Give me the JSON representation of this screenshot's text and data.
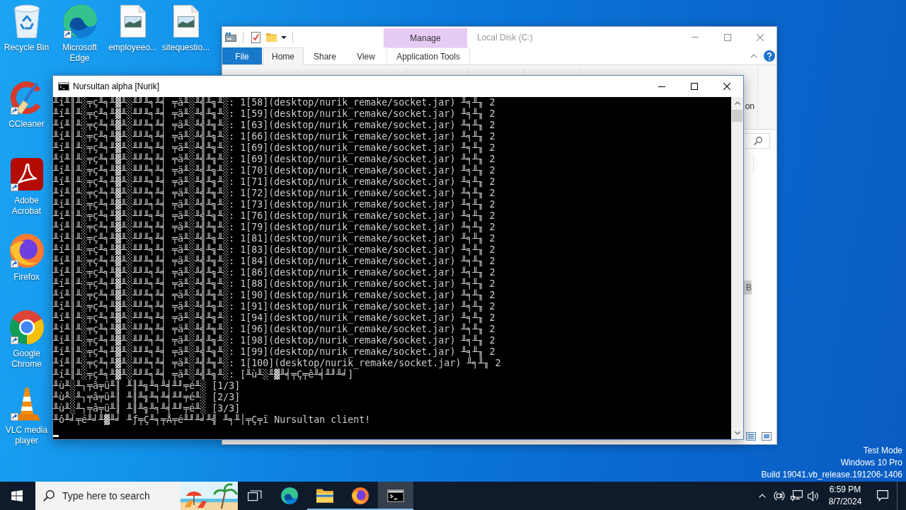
{
  "desktop_icons": [
    {
      "label": "Recycle Bin",
      "kind": "recycle-bin",
      "shortcut": false
    },
    {
      "label": "Microsoft Edge",
      "kind": "edge",
      "shortcut": true
    },
    {
      "label": "employeeo...",
      "kind": "image-file",
      "shortcut": false
    },
    {
      "label": "sitequestio...",
      "kind": "image-file",
      "shortcut": false
    },
    {
      "label": "CCleaner",
      "kind": "ccleaner",
      "shortcut": true
    },
    {
      "label": "Adobe Acrobat",
      "kind": "acrobat",
      "shortcut": true
    },
    {
      "label": "Firefox",
      "kind": "firefox",
      "shortcut": true
    },
    {
      "label": "Google Chrome",
      "kind": "chrome",
      "shortcut": true
    },
    {
      "label": "VLC media player",
      "kind": "vlc",
      "shortcut": true
    }
  ],
  "explorer_window": {
    "title": "Local Disk (C:)",
    "active": false,
    "contextual_group": "Manage",
    "ribbon_tabs": [
      {
        "label": "File",
        "kind": "file",
        "selected": false
      },
      {
        "label": "Home",
        "kind": "standard",
        "selected": true
      },
      {
        "label": "Share",
        "kind": "standard",
        "selected": false
      },
      {
        "label": "View",
        "kind": "standard",
        "selected": false
      },
      {
        "label": "Application Tools",
        "kind": "contextual",
        "selected": false
      }
    ],
    "ribbon_label_fragment": "on",
    "file_rows": [
      {
        "size_fragment": "B",
        "selected": true
      }
    ]
  },
  "console_window": {
    "title": "Nursultan alpha [Nurik]",
    "active": true,
    "lines": [
      "╨í╨║╨░╤ç╨╕╨▓╨░╨╜╨╕╨╡ ╤ä╨░╨╣╨╗╨░: 1[58](desktop/nurik_remake/socket.jar) ╨╕╨╖ 2",
      "╨í╨║╨░╤ç╨╕╨▓╨░╨╜╨╕╨╡ ╤ä╨░╨╣╨╗╨░: 1[59](desktop/nurik_remake/socket.jar) ╨╕╨╖ 2",
      "╨í╨║╨░╤ç╨╕╨▓╨░╨╜╨╕╨╡ ╤ä╨░╨╣╨╗╨░: 1[63](desktop/nurik_remake/socket.jar) ╨╕╨╖ 2",
      "╨í╨║╨░╤ç╨╕╨▓╨░╨╜╨╕╨╡ ╤ä╨░╨╣╨╗╨░: 1[66](desktop/nurik_remake/socket.jar) ╨╕╨╖ 2",
      "╨í╨║╨░╤ç╨╕╨▓╨░╨╜╨╕╨╡ ╤ä╨░╨╣╨╗╨░: 1[69](desktop/nurik_remake/socket.jar) ╨╕╨╖ 2",
      "╨í╨║╨░╤ç╨╕╨▓╨░╨╜╨╕╨╡ ╤ä╨░╨╣╨╗╨░: 1[69](desktop/nurik_remake/socket.jar) ╨╕╨╖ 2",
      "╨í╨║╨░╤ç╨╕╨▓╨░╨╜╨╕╨╡ ╤ä╨░╨╣╨╗╨░: 1[70](desktop/nurik_remake/socket.jar) ╨╕╨╖ 2",
      "╨í╨║╨░╤ç╨╕╨▓╨░╨╜╨╕╨╡ ╤ä╨░╨╣╨╗╨░: 1[71](desktop/nurik_remake/socket.jar) ╨╕╨╖ 2",
      "╨í╨║╨░╤ç╨╕╨▓╨░╨╜╨╕╨╡ ╤ä╨░╨╣╨╗╨░: 1[72](desktop/nurik_remake/socket.jar) ╨╕╨╖ 2",
      "╨í╨║╨░╤ç╨╕╨▓╨░╨╜╨╕╨╡ ╤ä╨░╨╣╨╗╨░: 1[73](desktop/nurik_remake/socket.jar) ╨╕╨╖ 2",
      "╨í╨║╨░╤ç╨╕╨▓╨░╨╜╨╕╨╡ ╤ä╨░╨╣╨╗╨░: 1[76](desktop/nurik_remake/socket.jar) ╨╕╨╖ 2",
      "╨í╨║╨░╤ç╨╕╨▓╨░╨╜╨╕╨╡ ╤ä╨░╨╣╨╗╨░: 1[79](desktop/nurik_remake/socket.jar) ╨╕╨╖ 2",
      "╨í╨║╨░╤ç╨╕╨▓╨░╨╜╨╕╨╡ ╤ä╨░╨╣╨╗╨░: 1[81](desktop/nurik_remake/socket.jar) ╨╕╨╖ 2",
      "╨í╨║╨░╤ç╨╕╨▓╨░╨╜╨╕╨╡ ╤ä╨░╨╣╨╗╨░: 1[83](desktop/nurik_remake/socket.jar) ╨╕╨╖ 2",
      "╨í╨║╨░╤ç╨╕╨▓╨░╨╜╨╕╨╡ ╤ä╨░╨╣╨╗╨░: 1[84](desktop/nurik_remake/socket.jar) ╨╕╨╖ 2",
      "╨í╨║╨░╤ç╨╕╨▓╨░╨╜╨╕╨╡ ╤ä╨░╨╣╨╗╨░: 1[86](desktop/nurik_remake/socket.jar) ╨╕╨╖ 2",
      "╨í╨║╨░╤ç╨╕╨▓╨░╨╜╨╕╨╡ ╤ä╨░╨╣╨╗╨░: 1[88](desktop/nurik_remake/socket.jar) ╨╕╨╖ 2",
      "╨í╨║╨░╤ç╨╕╨▓╨░╨╜╨╕╨╡ ╤ä╨░╨╣╨╗╨░: 1[90](desktop/nurik_remake/socket.jar) ╨╕╨╖ 2",
      "╨í╨║╨░╤ç╨╕╨▓╨░╨╜╨╕╨╡ ╤ä╨░╨╣╨╗╨░: 1[91](desktop/nurik_remake/socket.jar) ╨╕╨╖ 2",
      "╨í╨║╨░╤ç╨╕╨▓╨░╨╜╨╕╨╡ ╤ä╨░╨╣╨╗╨░: 1[94](desktop/nurik_remake/socket.jar) ╨╕╨╖ 2",
      "╨í╨║╨░╤ç╨╕╨▓╨░╨╜╨╕╨╡ ╤ä╨░╨╣╨╗╨░: 1[96](desktop/nurik_remake/socket.jar) ╨╕╨╖ 2",
      "╨í╨║╨░╤ç╨╕╨▓╨░╨╜╨╕╨╡ ╤ä╨░╨╣╨╗╨░: 1[98](desktop/nurik_remake/socket.jar) ╨╕╨╖ 2",
      "╨í╨║╨░╤ç╨╕╨▓╨░╨╜╨╕╨╡ ╤ä╨░╨╣╨╗╨░: 1[99](desktop/nurik_remake/socket.jar) ╨╕╨╖ 2",
      "╨í╨║╨░╤ç╨╕╨▓╨░╨╜╨╕╨╡ ╤ä╨░╨╣╨╗╨░: 1[100](desktop/nurik_remake/socket.jar) ╨╕╨╖ 2",
      "╨í╨║╨░╤ç╨╕╨▓╨░╨╜╨╕╨╡ ╤ä╨░╨╣╨╗╨░: [╨ù╨░╨▓╨╡╤Ç╤ê╨╡╨╜╨╛]",
      "╨ù╨░╨┐╤â╤ü╨║ ╨║╨╗╨╕╨╡╨╜╤é╨░ [1/3]",
      "╨ù╨░╨┐╤â╤ü╨║ ╨║╨╗╨╕╨╡╨╜╤é╨░ [2/3]",
      "╨ù╨░╨┐╤â╤ü╨║ ╨║╨╗╨╕╨╡╨╜╤é╨░ [3/3]",
      "╨ô╨╛╤é╨╛╨▓╨╛ ╨ƒ╤Ç╨╕╤Å╤é╨╜╨╛╨╣ ╨╕╨│╤Ç╤ï Nursultan client!"
    ]
  },
  "system_notice": [
    "Test Mode",
    "Windows 10 Pro",
    "Build 19041.vb_release.191206-1406"
  ],
  "taskbar": {
    "search": {
      "placeholder": "Type here to search"
    },
    "apps": [
      {
        "kind": "edge",
        "running": false,
        "selected": false
      },
      {
        "kind": "explorer",
        "running": true,
        "selected": false
      },
      {
        "kind": "firefox",
        "running": true,
        "selected": false
      },
      {
        "kind": "console",
        "running": true,
        "selected": true
      }
    ],
    "clock": {
      "time": "6:59 PM",
      "date": "8/7/2024"
    }
  }
}
